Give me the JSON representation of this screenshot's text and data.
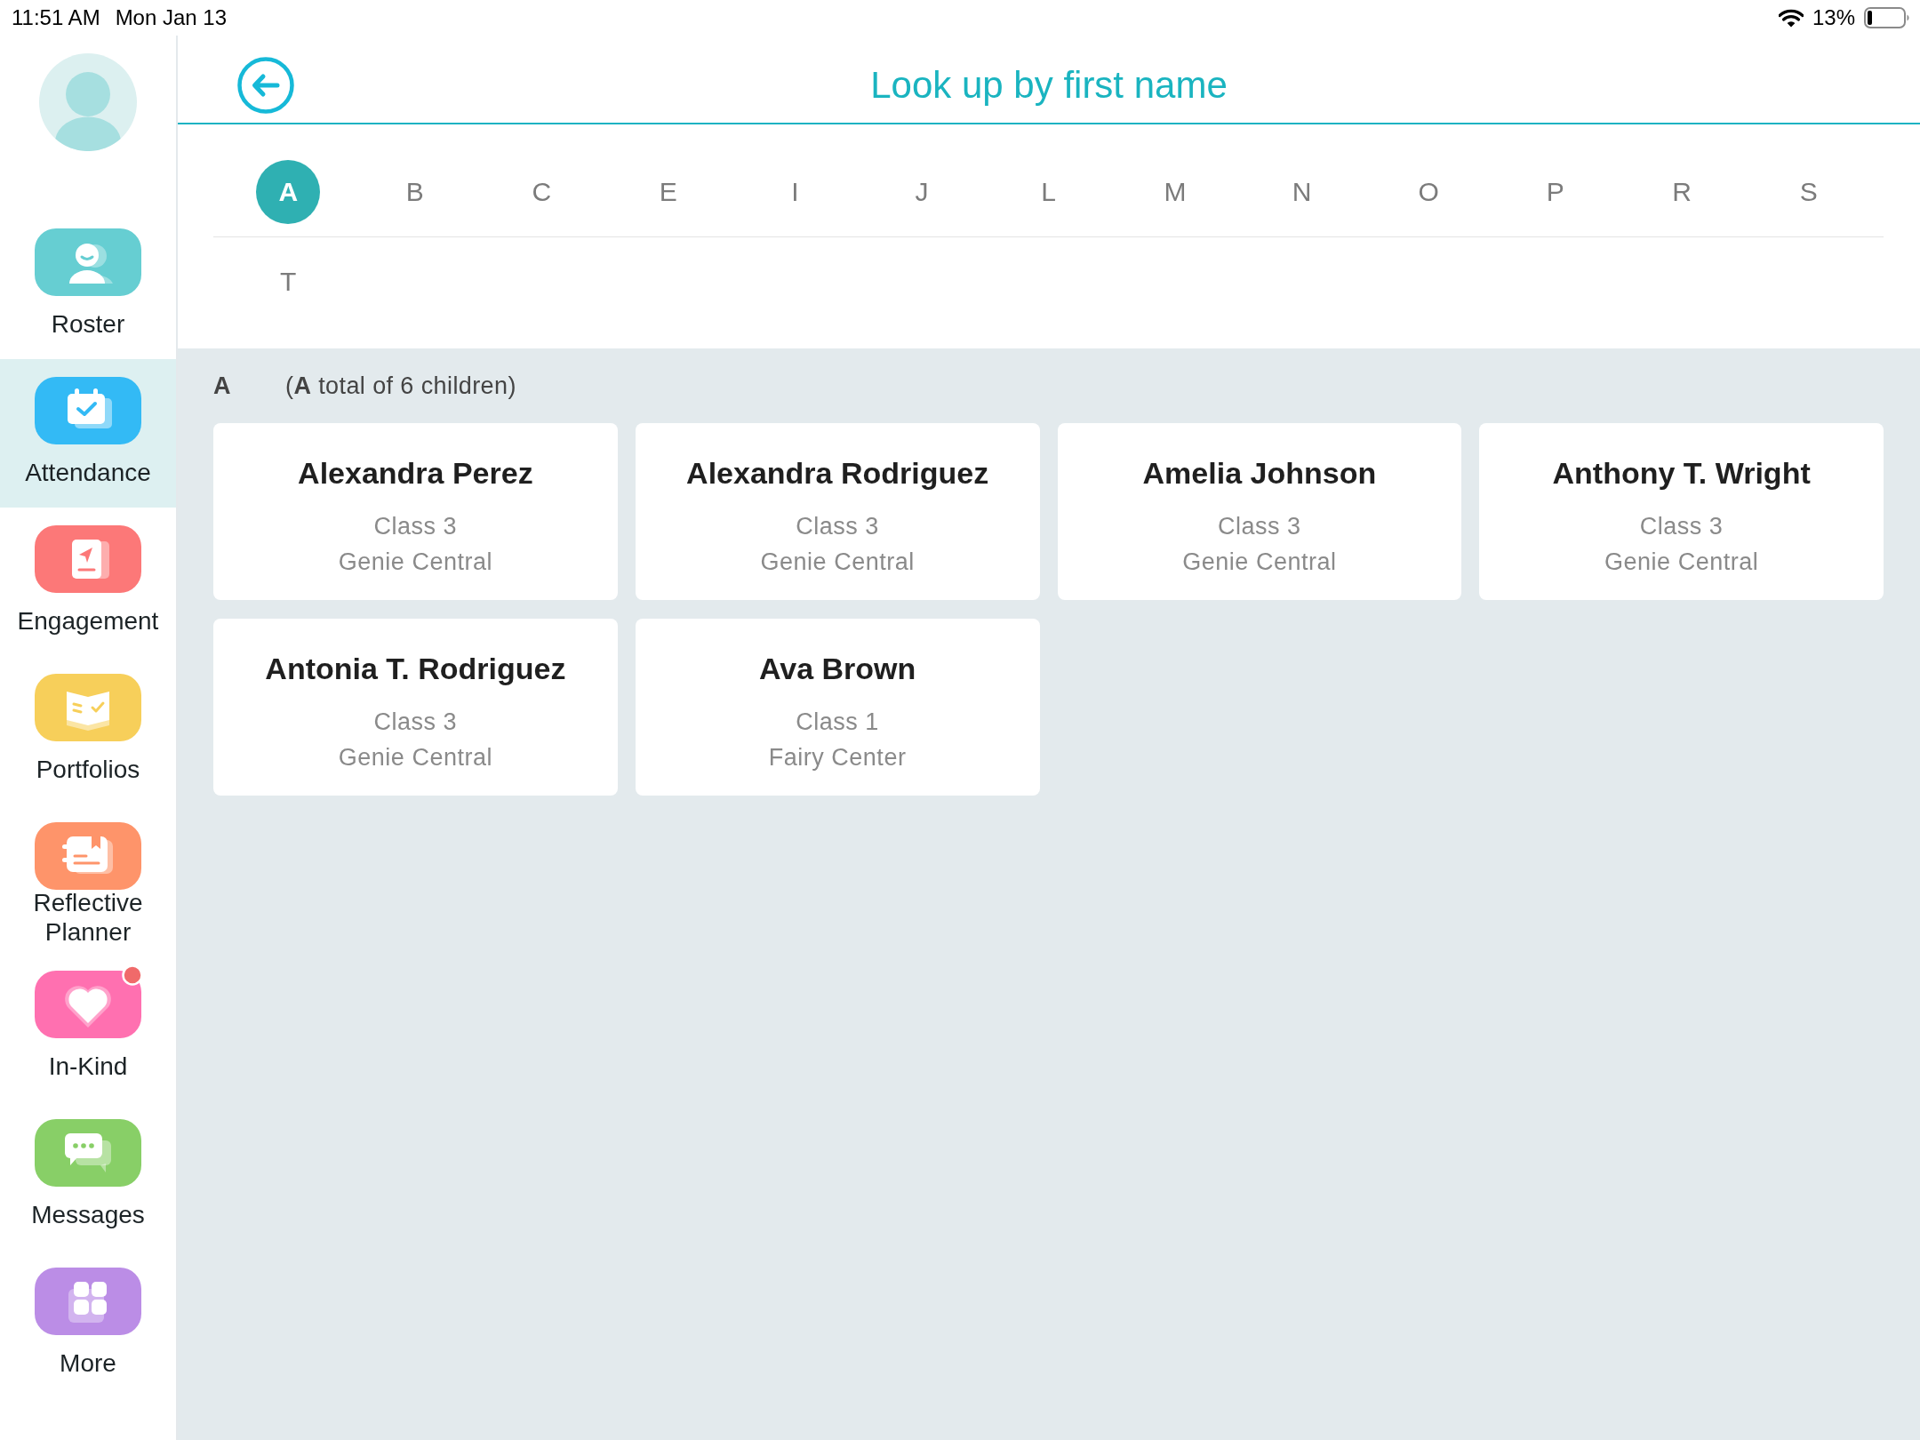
{
  "status_bar": {
    "time": "11:51 AM",
    "date": "Mon Jan 13",
    "battery": "13%"
  },
  "sidebar": {
    "items": [
      {
        "label": "Roster",
        "selected": false,
        "notification": false,
        "color": "#66ced2"
      },
      {
        "label": "Attendance",
        "selected": true,
        "notification": false,
        "color": "#33baf5"
      },
      {
        "label": "Engagement",
        "selected": false,
        "notification": false,
        "color": "#fc7878"
      },
      {
        "label": "Portfolios",
        "selected": false,
        "notification": false,
        "color": "#f7cf5a"
      },
      {
        "label": "Reflective Planner",
        "selected": false,
        "notification": false,
        "color": "#fe946a"
      },
      {
        "label": "In-Kind",
        "selected": false,
        "notification": true,
        "color": "#ff70b0"
      },
      {
        "label": "Messages",
        "selected": false,
        "notification": false,
        "color": "#88cf67"
      },
      {
        "label": "More",
        "selected": false,
        "notification": false,
        "color": "#bb8de6"
      }
    ]
  },
  "header": {
    "title": "Look up by first name"
  },
  "letters": [
    {
      "label": "A",
      "selected": true
    },
    {
      "label": "B",
      "selected": false
    },
    {
      "label": "C",
      "selected": false
    },
    {
      "label": "E",
      "selected": false
    },
    {
      "label": "I",
      "selected": false
    },
    {
      "label": "J",
      "selected": false
    },
    {
      "label": "L",
      "selected": false
    },
    {
      "label": "M",
      "selected": false
    },
    {
      "label": "N",
      "selected": false
    },
    {
      "label": "O",
      "selected": false
    },
    {
      "label": "P",
      "selected": false
    },
    {
      "label": "R",
      "selected": false
    },
    {
      "label": "S",
      "selected": false
    },
    {
      "label": "T",
      "selected": false
    }
  ],
  "section": {
    "letter": "A",
    "summary": "(**A** total of 6 children)",
    "children": [
      {
        "name": "Alexandra Perez",
        "class": "Class 3",
        "center": "Genie Central"
      },
      {
        "name": "Alexandra Rodriguez",
        "class": "Class 3",
        "center": "Genie Central"
      },
      {
        "name": "Amelia Johnson",
        "class": "Class 3",
        "center": "Genie Central"
      },
      {
        "name": "Anthony T. Wright",
        "class": "Class 3",
        "center": "Genie Central"
      },
      {
        "name": "Antonia T. Rodriguez",
        "class": "Class 3",
        "center": "Genie Central"
      },
      {
        "name": "Ava Brown",
        "class": "Class 1",
        "center": "Fairy Center"
      }
    ]
  }
}
